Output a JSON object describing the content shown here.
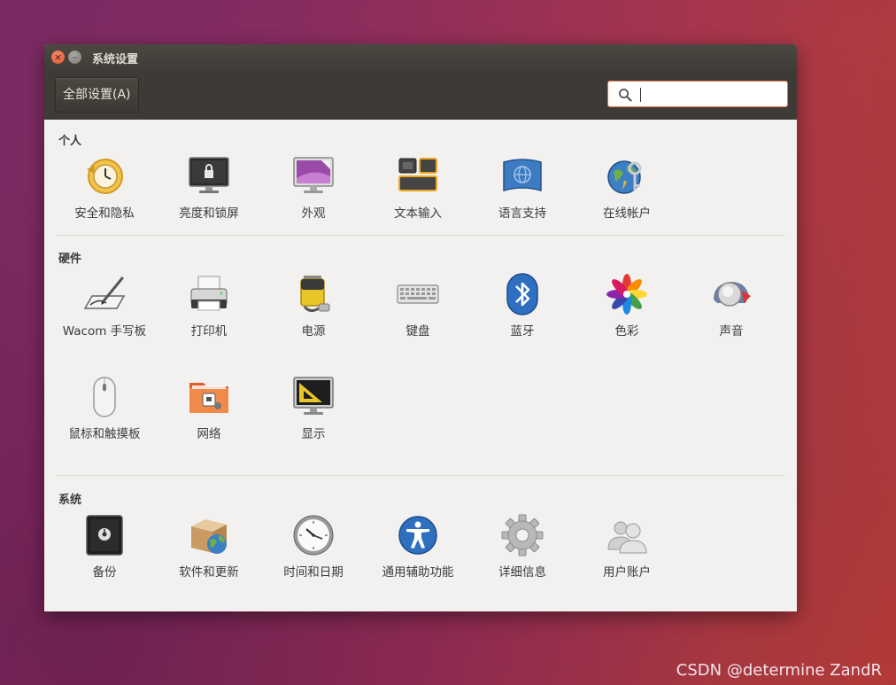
{
  "window": {
    "title": "系统设置"
  },
  "titlebar": {
    "close_glyph": "×",
    "min_glyph": "–"
  },
  "toolbar": {
    "all_settings_label": "全部设置(A)",
    "search_value": ""
  },
  "sections": {
    "personal": {
      "title": "个人",
      "items": [
        {
          "label": "安全和隐私",
          "icon": "security-privacy-icon"
        },
        {
          "label": "亮度和锁屏",
          "icon": "brightness-lock-icon"
        },
        {
          "label": "外观",
          "icon": "appearance-icon"
        },
        {
          "label": "文本输入",
          "icon": "text-entry-icon"
        },
        {
          "label": "语言支持",
          "icon": "language-support-icon"
        },
        {
          "label": "在线帐户",
          "icon": "online-accounts-icon"
        }
      ]
    },
    "hardware": {
      "title": "硬件",
      "items": [
        {
          "label": "Wacom 手写板",
          "icon": "wacom-tablet-icon"
        },
        {
          "label": "打印机",
          "icon": "printer-icon"
        },
        {
          "label": "电源",
          "icon": "power-icon"
        },
        {
          "label": "键盘",
          "icon": "keyboard-icon"
        },
        {
          "label": "蓝牙",
          "icon": "bluetooth-icon"
        },
        {
          "label": "色彩",
          "icon": "color-icon"
        },
        {
          "label": "声音",
          "icon": "sound-icon"
        },
        {
          "label": "鼠标和触摸板",
          "icon": "mouse-touchpad-icon"
        },
        {
          "label": "网络",
          "icon": "network-icon"
        },
        {
          "label": "显示",
          "icon": "display-icon"
        }
      ]
    },
    "system": {
      "title": "系统",
      "items": [
        {
          "label": "备份",
          "icon": "backup-icon"
        },
        {
          "label": "软件和更新",
          "icon": "software-updates-icon"
        },
        {
          "label": "时间和日期",
          "icon": "time-date-icon"
        },
        {
          "label": "通用辅助功能",
          "icon": "universal-access-icon"
        },
        {
          "label": "详细信息",
          "icon": "details-icon"
        },
        {
          "label": "用户账户",
          "icon": "user-accounts-icon"
        }
      ]
    }
  },
  "watermark": "CSDN @determine  ZandR",
  "colors": {
    "accent": "#e8794f",
    "toolbar": "#3e3b36",
    "window_bg": "#f2f1f0"
  }
}
